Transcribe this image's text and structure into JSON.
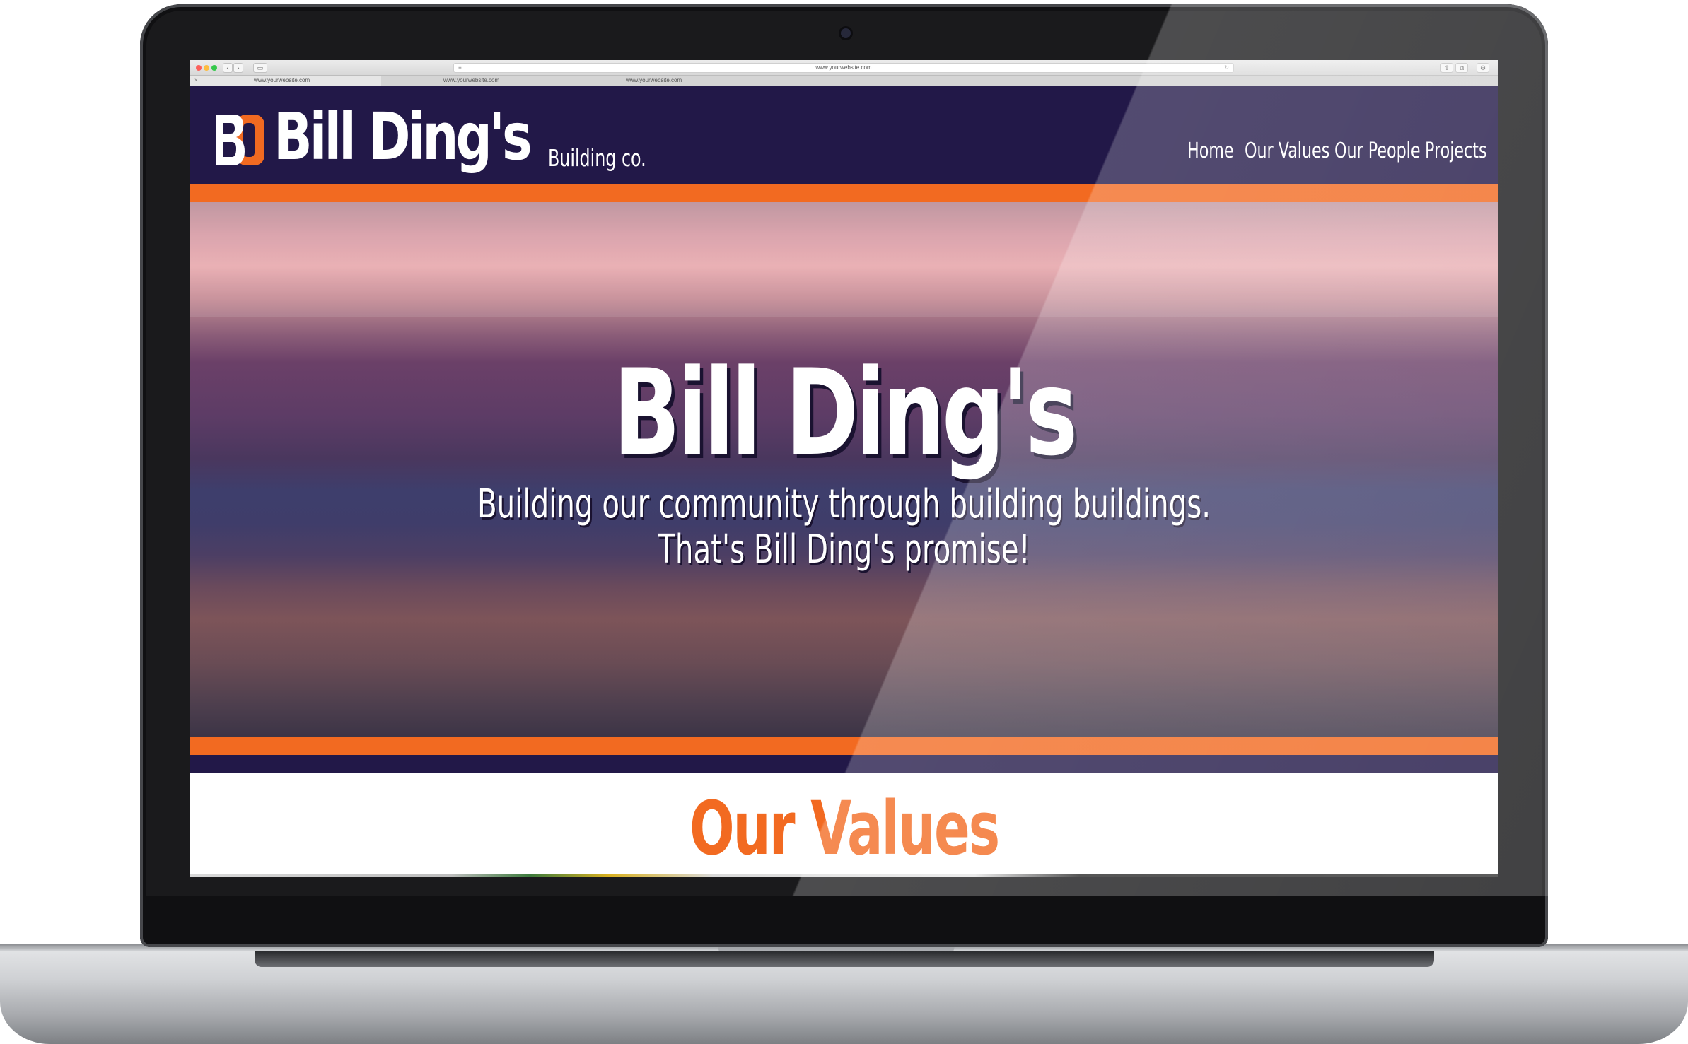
{
  "browser": {
    "url": "www.yourwebsite.com",
    "tabs": [
      {
        "label": "www.yourwebsite.com"
      },
      {
        "label": "www.yourwebsite.com"
      },
      {
        "label": "www.yourwebsite.com"
      }
    ],
    "tab_close": "×",
    "controls": {
      "back": "‹",
      "forward": "›",
      "sidebar": "▭",
      "reader": "≡",
      "reload": "↻",
      "share": "⇧",
      "tabs_overview": "⧉",
      "downloads": "⚙"
    }
  },
  "site": {
    "logo_text": "BD",
    "brand": "Bill Ding's",
    "tagline": "Building co.",
    "nav": [
      {
        "label": "Home"
      },
      {
        "label": "Our Values"
      },
      {
        "label": "Our People"
      },
      {
        "label": "Projects"
      }
    ],
    "hero": {
      "title": "Bill Ding's",
      "subtitle_line1": "Building our community through building buildings.",
      "subtitle_line2": "That's Bill Ding's promise!"
    },
    "values_heading": "Our Values"
  },
  "colors": {
    "brand_navy": "#221848",
    "brand_orange": "#f26a21",
    "text_white": "#ffffff"
  }
}
